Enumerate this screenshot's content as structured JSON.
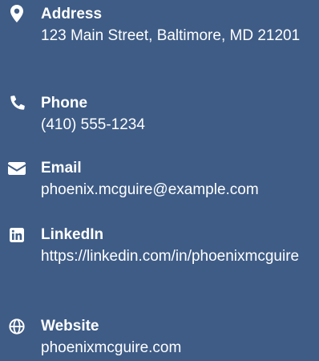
{
  "contacts": [
    {
      "id": "address",
      "label": "Address",
      "value": "123 Main Street, Baltimore, MD 21201",
      "icon": "map-marker-icon"
    },
    {
      "id": "phone",
      "label": "Phone",
      "value": "(410) 555-1234",
      "icon": "phone-icon"
    },
    {
      "id": "email",
      "label": "Email",
      "value": "phoenix.mcguire@example.com",
      "icon": "envelope-icon"
    },
    {
      "id": "linkedin",
      "label": "LinkedIn",
      "value": "https://linkedin.com/in/phoenixmcguire",
      "icon": "linkedin-icon"
    },
    {
      "id": "website",
      "label": "Website",
      "value": "phoenixmcguire.com",
      "icon": "globe-icon"
    }
  ],
  "colors": {
    "background": "#3e5c86",
    "text": "#ffffff"
  }
}
